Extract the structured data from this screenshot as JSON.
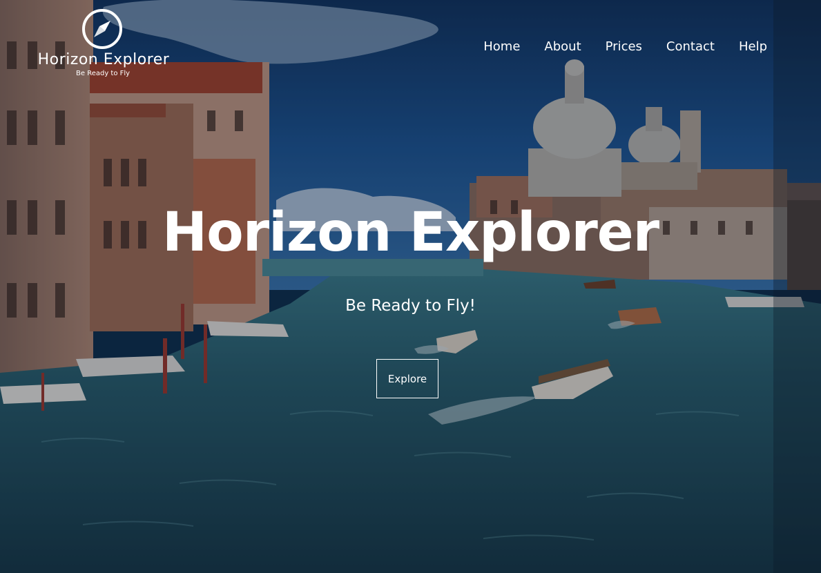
{
  "brand": {
    "name": "Horizon Explorer",
    "tagline": "Be Ready to Fly",
    "icon": "compass-icon"
  },
  "nav": {
    "items": [
      {
        "label": "Home"
      },
      {
        "label": "About"
      },
      {
        "label": "Prices"
      },
      {
        "label": "Contact"
      },
      {
        "label": "Help"
      }
    ]
  },
  "hero": {
    "title": "Horizon Explorer",
    "subtitle": "Be Ready to Fly!",
    "cta_label": "Explore",
    "background": "venice-grand-canal-photo"
  },
  "colors": {
    "text": "#ffffff",
    "sky": "#1b4f8a",
    "water": "#1f4a5e"
  }
}
